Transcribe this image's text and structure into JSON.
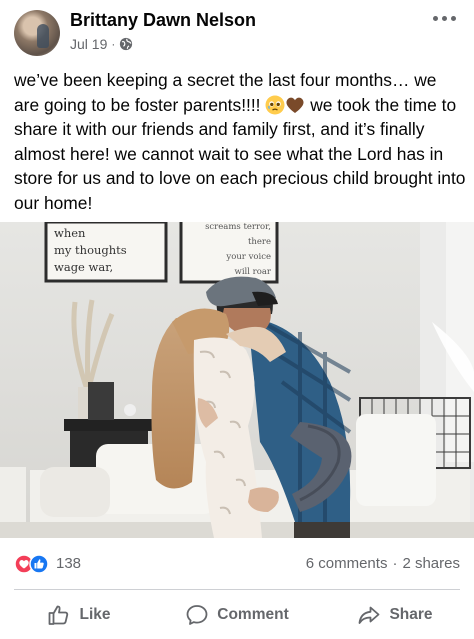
{
  "post": {
    "author": "Brittany Dawn Nelson",
    "date": "Jul 19",
    "separator": "·",
    "privacy_icon": "globe-icon",
    "more_icon": "more-dots-icon",
    "caption_part1": "we’ve been keeping a secret the last four months… we are going to be foster parents!!!! ",
    "caption_part2": " we took the time to share it with our friends and family first, and it’s finally almost here! we cannot wait to see what the Lord has in store for us and to love on each precious child brought into our home!",
    "caption_emojis": [
      "pleading-face-emoji",
      "brown-heart-emoji"
    ]
  },
  "photo": {
    "sign_left": [
      "when",
      "my thoughts",
      "wage war,"
    ],
    "sign_right": [
      "screams terror,",
      "there",
      "your voice",
      "will roar"
    ]
  },
  "reactions": {
    "icons": [
      "love-reaction-icon",
      "like-reaction-icon"
    ],
    "count": "138",
    "comments": "6 comments",
    "dot": "·",
    "shares": "2 shares"
  },
  "actions": {
    "like_label": "Like",
    "comment_label": "Comment",
    "share_label": "Share"
  },
  "colors": {
    "text": "#050505",
    "secondary": "#65676b",
    "like_blue": "#1877f2",
    "love_red": "#f33e58"
  }
}
